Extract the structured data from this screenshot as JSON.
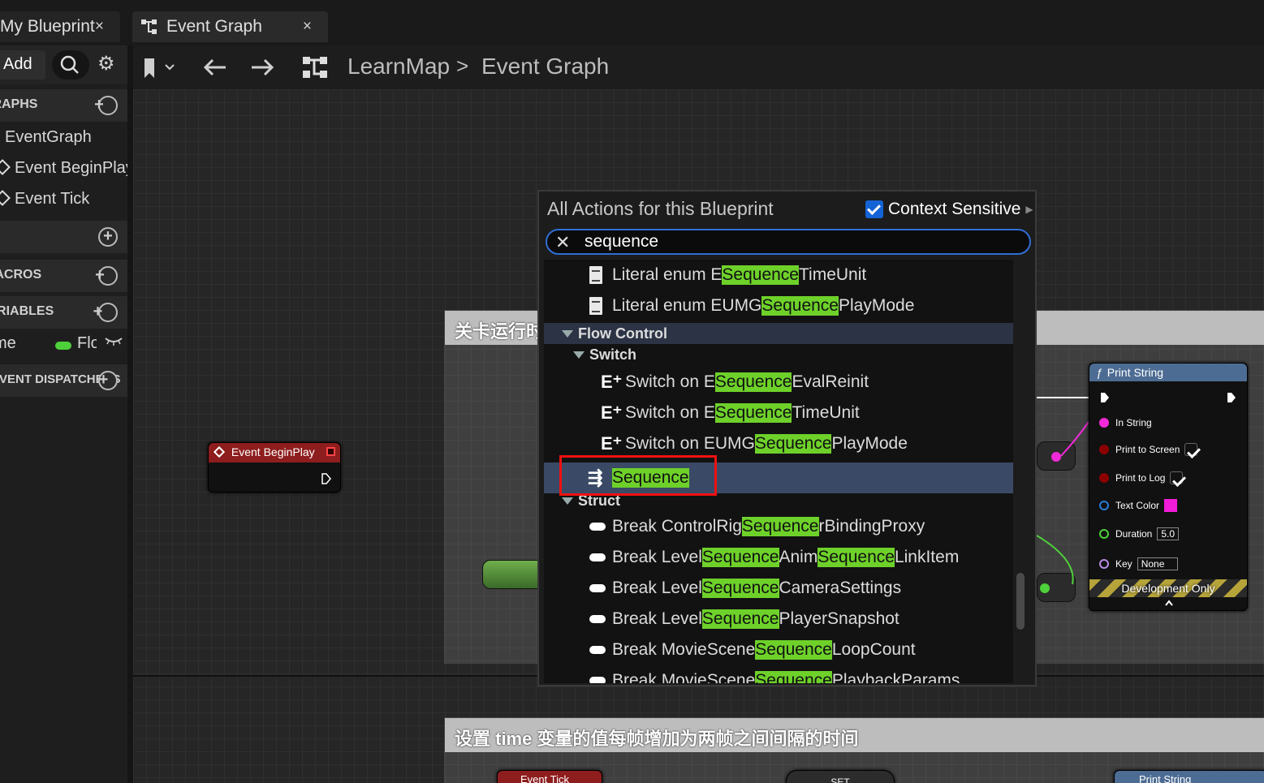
{
  "tabs": [
    {
      "label": "My Blueprint",
      "close": "×"
    },
    {
      "label": "Event Graph",
      "close": "×"
    }
  ],
  "left_panel": {
    "add_label": "Add",
    "sections": {
      "graphs": "GRAPHS",
      "macros": "MACROS",
      "variables": "VARIABLES",
      "dispatchers": "EVENT DISPATCHERS"
    },
    "graph_items": [
      "EventGraph",
      "Event BeginPlay",
      "Event Tick"
    ],
    "variable": {
      "name": "time",
      "type": "Float"
    }
  },
  "graph_toolbar": {
    "breadcrumb_root": "LearnMap",
    "breadcrumb_separator": ">",
    "breadcrumb_current": "Event Graph"
  },
  "comments": {
    "top": "关卡运行时",
    "bottom": "设置 time 变量的值每帧增加为两帧之间间隔的时间"
  },
  "nodes": {
    "begin_play": "Event BeginPlay",
    "event_tick": "Event Tick",
    "set": "SET",
    "print_string": {
      "title": "Print String",
      "pins": [
        "In String",
        "Print to Screen",
        "Print to Log",
        "Text Color",
        "Duration",
        "Key"
      ],
      "duration_value": "5.0",
      "key_value": "None",
      "footer": "Development Only"
    },
    "print_string_2": "Print String"
  },
  "action_menu": {
    "title": "All Actions for this Blueprint",
    "context_sensitive_label": "Context Sensitive",
    "context_sensitive_checked": true,
    "search_value": "sequence",
    "highlight_color": "#6ed12a",
    "items": [
      {
        "pre": "Literal enum E",
        "hl": "Sequence",
        "post": "TimeUnit",
        "icon": "document-icon"
      },
      {
        "pre": "Literal enum EUMG",
        "hl": "Sequence",
        "post": "PlayMode",
        "icon": "document-icon"
      },
      {
        "category": "Flow Control"
      },
      {
        "subcategory": "Switch"
      },
      {
        "pre": "Switch on E",
        "hl": "Sequence",
        "post": "EvalReinit",
        "icon": "switch-icon"
      },
      {
        "pre": "Switch on E",
        "hl": "Sequence",
        "post": "TimeUnit",
        "icon": "switch-icon"
      },
      {
        "pre": "Switch on EUMG",
        "hl": "Sequence",
        "post": "PlayMode",
        "icon": "switch-icon"
      },
      {
        "pre": "",
        "hl": "Sequence",
        "post": "",
        "icon": "sequence-icon",
        "selected": true
      },
      {
        "category": "Struct"
      },
      {
        "pre": "Break ControlRig",
        "hl": "Sequence",
        "post": "rBindingProxy",
        "icon": "struct-icon"
      },
      {
        "pre": "Break Level",
        "hl": "Sequence",
        "post": "Anim",
        "hl2": "Sequence",
        "post2": "LinkItem",
        "icon": "struct-icon"
      },
      {
        "pre": "Break Level",
        "hl": "Sequence",
        "post": "CameraSettings",
        "icon": "struct-icon"
      },
      {
        "pre": "Break Level",
        "hl": "Sequence",
        "post": "PlayerSnapshot",
        "icon": "struct-icon"
      },
      {
        "pre": "Break MovieScene",
        "hl": "Sequence",
        "post": "LoopCount",
        "icon": "struct-icon"
      },
      {
        "pre": "Break MovieScene",
        "hl": "Sequence",
        "post": "PlaybackParams",
        "icon": "struct-icon"
      }
    ]
  }
}
